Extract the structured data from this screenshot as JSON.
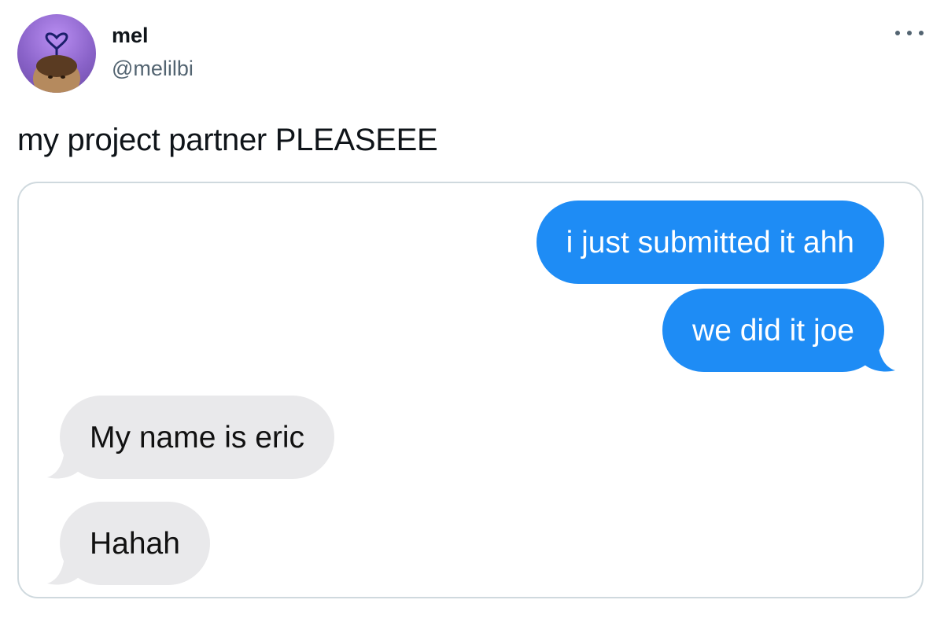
{
  "author": {
    "display_name": "mel",
    "handle": "@melilbi",
    "avatar_icon": "avatar-photo-icon"
  },
  "tweet": {
    "text": "my project partner PLEASEEE"
  },
  "colors": {
    "sent_bubble": "#1e8cf5",
    "received_bubble": "#e9e9eb",
    "handle_gray": "#536471",
    "card_border": "#cfd9de"
  },
  "messages": [
    {
      "from": "me",
      "text": "i just submitted it ahh"
    },
    {
      "from": "me",
      "text": "we did it joe"
    },
    {
      "from": "them",
      "text": "My name is eric"
    },
    {
      "from": "them",
      "text": "Hahah"
    }
  ]
}
